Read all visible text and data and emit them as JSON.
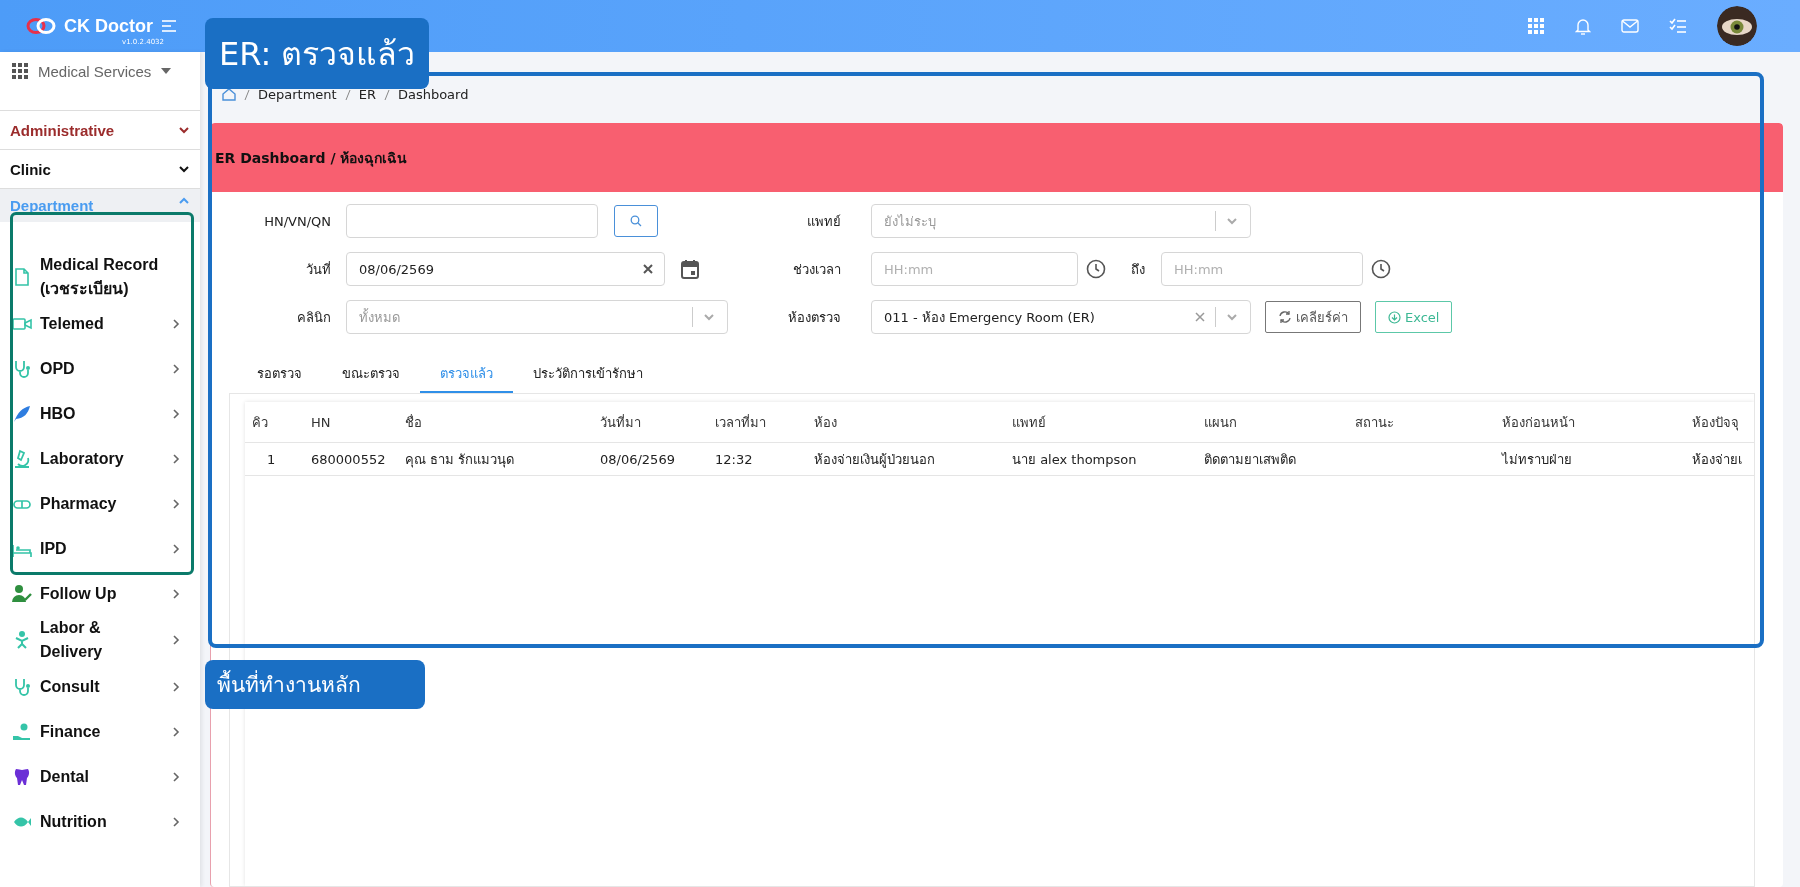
{
  "app": {
    "name": "CK Doctor",
    "version": "v1.0.2.4032"
  },
  "sidebar": {
    "module_picker": "Medical Services",
    "sections": [
      {
        "label": "Administrative",
        "color": "#9b2c2c",
        "expanded": false
      },
      {
        "label": "Clinic",
        "color": "#111111",
        "expanded": false
      },
      {
        "label": "Department",
        "color": "#4a9cf0",
        "expanded": true,
        "children": [
          {
            "label": "Medical Record (เวชระเบียน)",
            "has_submenu": false
          },
          {
            "label": "Telemed",
            "has_submenu": true
          },
          {
            "label": "OPD",
            "has_submenu": true
          },
          {
            "label": "HBO",
            "has_submenu": true
          },
          {
            "label": "Laboratory",
            "has_submenu": true
          },
          {
            "label": "Pharmacy",
            "has_submenu": true
          },
          {
            "label": "IPD",
            "has_submenu": true
          },
          {
            "label": "Follow Up",
            "has_submenu": true
          },
          {
            "label": "Labor & Delivery",
            "has_submenu": true
          },
          {
            "label": "Consult",
            "has_submenu": true
          },
          {
            "label": "Finance",
            "has_submenu": true
          },
          {
            "label": "Dental",
            "has_submenu": true
          },
          {
            "label": "Nutrition",
            "has_submenu": true
          }
        ]
      }
    ]
  },
  "breadcrumb": [
    "Department",
    "ER",
    "Dashboard"
  ],
  "card": {
    "title": "ER Dashboard / ห้องฉุกเฉิน"
  },
  "filters": {
    "hn": {
      "label": "HN/VN/QN"
    },
    "doctor": {
      "label": "แพทย์",
      "placeholder": "ยังไม่ระบุ"
    },
    "date": {
      "label": "วันที่",
      "value": "08/06/2569"
    },
    "time_range": {
      "label": "ช่วงเวลา",
      "from_placeholder": "HH:mm",
      "to_label": "ถึง",
      "to_placeholder": "HH:mm"
    },
    "clinic": {
      "label": "คลินิก",
      "placeholder": "ทั้งหมด"
    },
    "room": {
      "label": "ห้องตรวจ",
      "value": "011 - ห้อง Emergency Room (ER)"
    },
    "buttons": {
      "clear": "เคลียร์ค่า",
      "excel": "Excel"
    }
  },
  "tabs": [
    {
      "label": "รอตรวจ",
      "selected": false
    },
    {
      "label": "ขณะตรวจ",
      "selected": false
    },
    {
      "label": "ตรวจแล้ว",
      "selected": true
    },
    {
      "label": "ประวัติการเข้ารักษา",
      "selected": false
    }
  ],
  "table": {
    "columns": [
      "คิว",
      "HN",
      "ชื่อ",
      "วันที่มา",
      "เวลาที่มา",
      "ห้อง",
      "แพทย์",
      "แผนก",
      "สถานะ",
      "ห้องก่อนหน้า",
      "ห้องปัจจุ"
    ],
    "rows": [
      {
        "queue": "1",
        "hn": "680000552",
        "name": "คุณ ธาม รักแมวนุด",
        "date": "08/06/2569",
        "time": "12:32",
        "room": "ห้องจ่ายเงินผู้ป่วยนอก",
        "doctor": "นาย alex thompson",
        "department": "ติดตามยาเสพติด",
        "previous_room": "ไม่ทราบฝ่าย",
        "current_room": "ห้องจ่ายเ"
      }
    ]
  },
  "highlights": [
    {
      "color": "#1a6fc4"
    },
    {
      "color": "#0b7a6a"
    }
  ],
  "callouts": [
    {
      "text": "ER: ตรวจแล้ว"
    },
    {
      "text": "พื้นที่ทำงานหลัก"
    }
  ]
}
